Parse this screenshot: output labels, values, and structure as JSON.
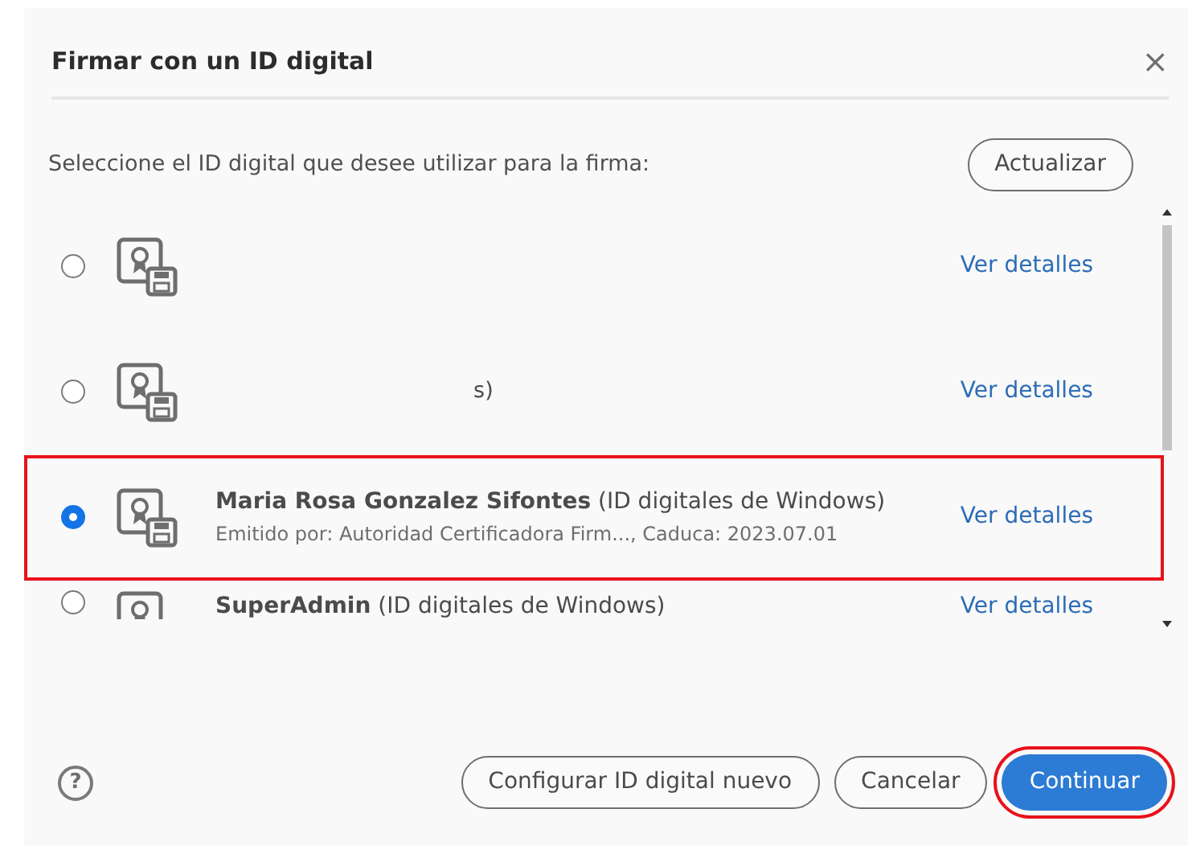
{
  "window": {
    "title": "Firmar con un ID digital",
    "close": "×"
  },
  "instruction": "Seleccione el ID digital que desee utilizar para la firma:",
  "refresh_button": "Actualizar",
  "ids": [
    {
      "selected": false,
      "highlighted": false,
      "link": "Ver detalles"
    },
    {
      "selected": false,
      "highlighted": false,
      "fragment": "s)",
      "link": "Ver detalles"
    },
    {
      "selected": true,
      "highlighted": true,
      "name": "Maria Rosa Gonzalez Sifontes",
      "source": "(ID digitales de Windows)",
      "issuer": "Emitido por: Autoridad Certificadora Firm..., Caduca: 2023.07.01",
      "link": "Ver detalles"
    },
    {
      "selected": false,
      "highlighted": false,
      "cut": true,
      "name": "SuperAdmin",
      "source": "(ID digitales de Windows)",
      "link": "Ver detalles"
    }
  ],
  "footer": {
    "help": "?",
    "buttons": [
      {
        "label": "Configurar ID digital nuevo",
        "kind": "secondary",
        "highlighted": false
      },
      {
        "label": "Cancelar",
        "kind": "secondary",
        "highlighted": false
      },
      {
        "label": "Continuar",
        "kind": "primary",
        "highlighted": true
      }
    ]
  }
}
